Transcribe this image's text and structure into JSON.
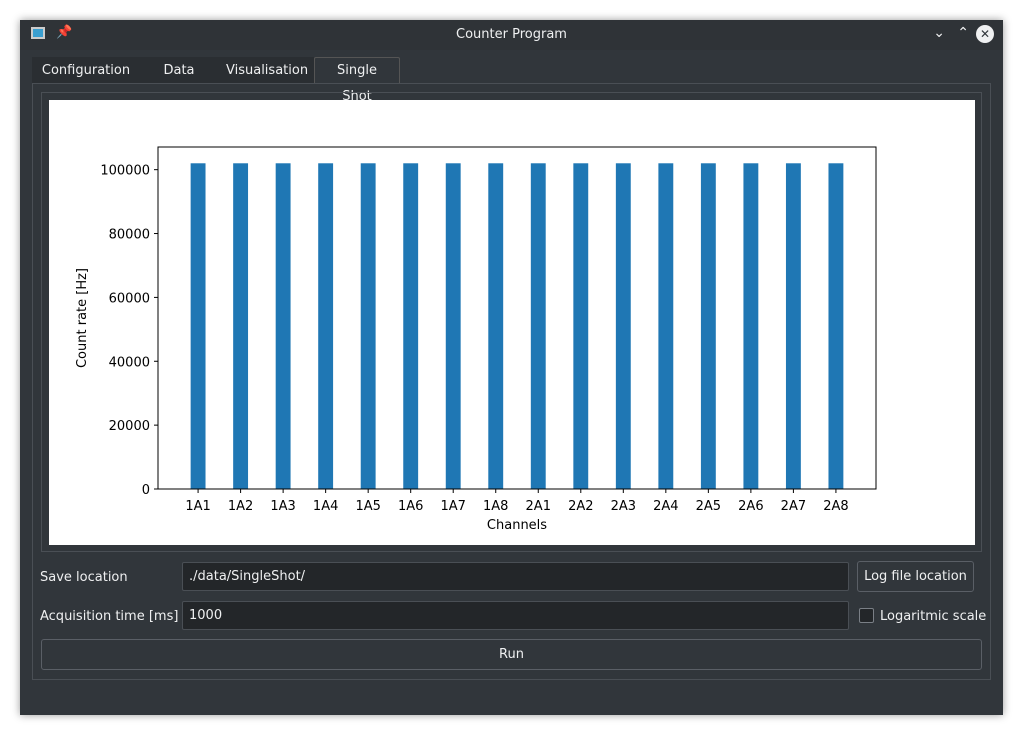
{
  "window": {
    "title": "Counter Program"
  },
  "tabs": [
    {
      "label": "Configuration"
    },
    {
      "label": "Data"
    },
    {
      "label": "Visualisation"
    },
    {
      "label": "Single Shot"
    }
  ],
  "form": {
    "save_label": "Save location",
    "save_value": "./data/SingleShot/",
    "log_button": "Log file location",
    "acq_label": "Acquisition time [ms]",
    "acq_value": "1000",
    "log_scale_label": "Logaritmic scale",
    "log_scale_checked": false,
    "run_button": "Run"
  },
  "chart_data": {
    "type": "bar",
    "title": "",
    "xlabel": "Channels",
    "ylabel": "Count rate [Hz]",
    "categories": [
      "1A1",
      "1A2",
      "1A3",
      "1A4",
      "1A5",
      "1A6",
      "1A7",
      "1A8",
      "2A1",
      "2A2",
      "2A3",
      "2A4",
      "2A5",
      "2A6",
      "2A7",
      "2A8"
    ],
    "values": [
      102000,
      102000,
      102000,
      102000,
      102000,
      102000,
      102000,
      102000,
      102000,
      102000,
      102000,
      102000,
      102000,
      102000,
      102000,
      102000
    ],
    "yticks": [
      0,
      20000,
      40000,
      60000,
      80000,
      100000
    ],
    "ylim": [
      0,
      107100
    ],
    "color": "#1f77b4",
    "grid": false
  }
}
